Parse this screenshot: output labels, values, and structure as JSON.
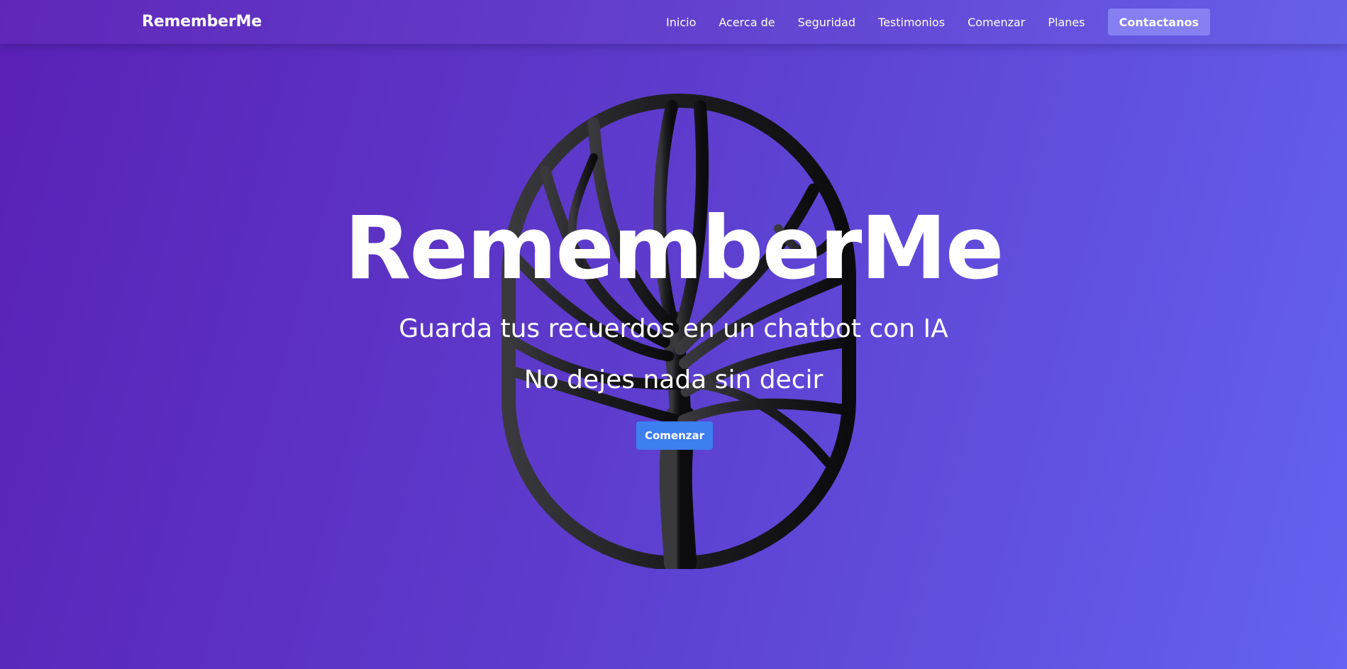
{
  "navbar": {
    "brand": "RememberMe",
    "links": [
      "Inicio",
      "Acerca de",
      "Seguridad",
      "Testimonios",
      "Comenzar",
      "Planes"
    ],
    "cta_label": "Contactanos"
  },
  "hero": {
    "title": "RememberMe",
    "subtitle": "Guarda tus recuerdos en un chatbot con IA",
    "tagline": "No dejes nada sin decir",
    "button_label": "Comenzar",
    "logo_icon": "tree-in-oval-icon"
  },
  "colors": {
    "gradient_start": "#5a21b6",
    "gradient_end": "#6462f0",
    "button_primary": "#3d7ef0",
    "nav_cta": "#8c87f5",
    "logo": "#1a1a1c"
  }
}
